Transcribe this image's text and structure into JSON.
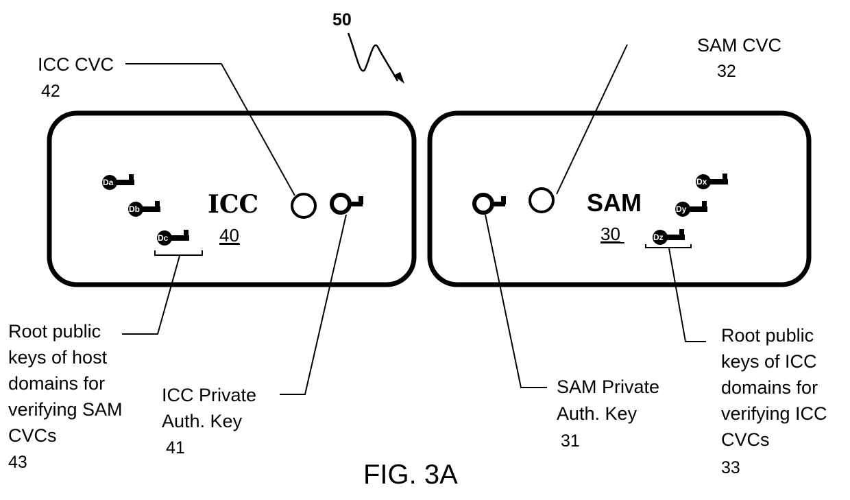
{
  "figure": {
    "caption": "FIG. 3A",
    "system_ref": "50"
  },
  "icc": {
    "name": "ICC",
    "ref": "40",
    "cvc_label": "ICC CVC",
    "cvc_ref": "42",
    "private_key_label_line1": "ICC Private",
    "private_key_label_line2": "Auth. Key",
    "private_key_ref": "41",
    "root_keys_label_lines": [
      "Root public",
      "keys of host",
      "domains for",
      "verifying SAM",
      "CVCs"
    ],
    "root_keys_ref": "43",
    "domain_keys": [
      "Da",
      "Db",
      "Dc"
    ]
  },
  "sam": {
    "name": "SAM",
    "ref": "30",
    "cvc_label": "SAM CVC",
    "cvc_ref": "32",
    "private_key_label_line1": "SAM Private",
    "private_key_label_line2": "Auth. Key",
    "private_key_ref": "31",
    "root_keys_label_lines": [
      "Root public",
      "keys of ICC",
      "domains for",
      "verifying ICC",
      "CVCs"
    ],
    "root_keys_ref": "33",
    "domain_keys": [
      "Dx",
      "Dy",
      "Dz"
    ]
  }
}
